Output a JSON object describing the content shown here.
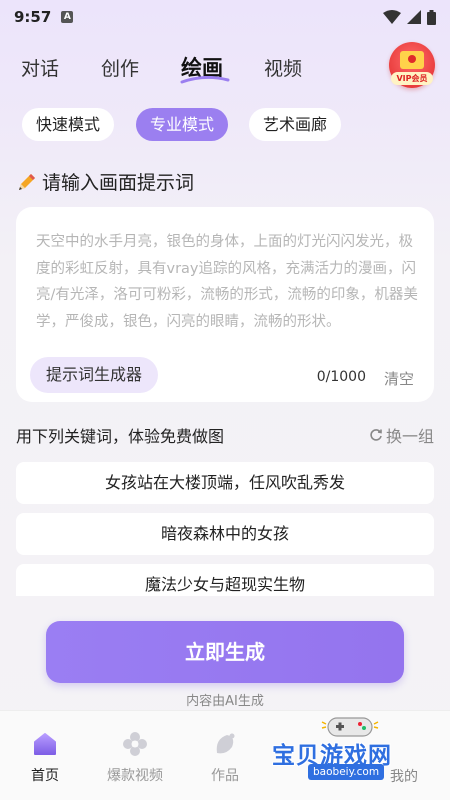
{
  "status": {
    "time": "9:57",
    "indicator": "A"
  },
  "top_tabs": [
    "对话",
    "创作",
    "绘画",
    "视频"
  ],
  "active_tab": "绘画",
  "vip": {
    "label": "VIP会员"
  },
  "modes": [
    "快速模式",
    "专业模式",
    "艺术画廊"
  ],
  "active_mode": "专业模式",
  "prompt": {
    "title": "请输入画面提示词",
    "placeholder": "天空中的水手月亮，银色的身体，上面的灯光闪闪发光，极度的彩虹反射，具有vray追踪的风格，充满活力的漫画，闪亮/有光泽，洛可可粉彩，流畅的形式，流畅的印象，机器美学，严俊成，银色，闪亮的眼睛，流畅的形状。",
    "generator_button": "提示词生成器",
    "counter": "0/1000",
    "clear": "清空"
  },
  "keywords": {
    "title": "用下列关键词，体验免费做图",
    "refresh": "换一组",
    "items": [
      "女孩站在大楼顶端，任风吹乱秀发",
      "暗夜森林中的女孩",
      "魔法少女与超现实生物"
    ]
  },
  "generate_button": "立即生成",
  "ai_note": "内容由AI生成",
  "bottom_nav": [
    "首页",
    "爆款视频",
    "作品",
    "我的"
  ],
  "watermark": {
    "title": "宝贝游戏网",
    "url": "baobeiy.com"
  },
  "colors": {
    "accent": "#9b7ff0",
    "accent_light": "#ede6fb",
    "watermark": "#2f6fe0"
  }
}
